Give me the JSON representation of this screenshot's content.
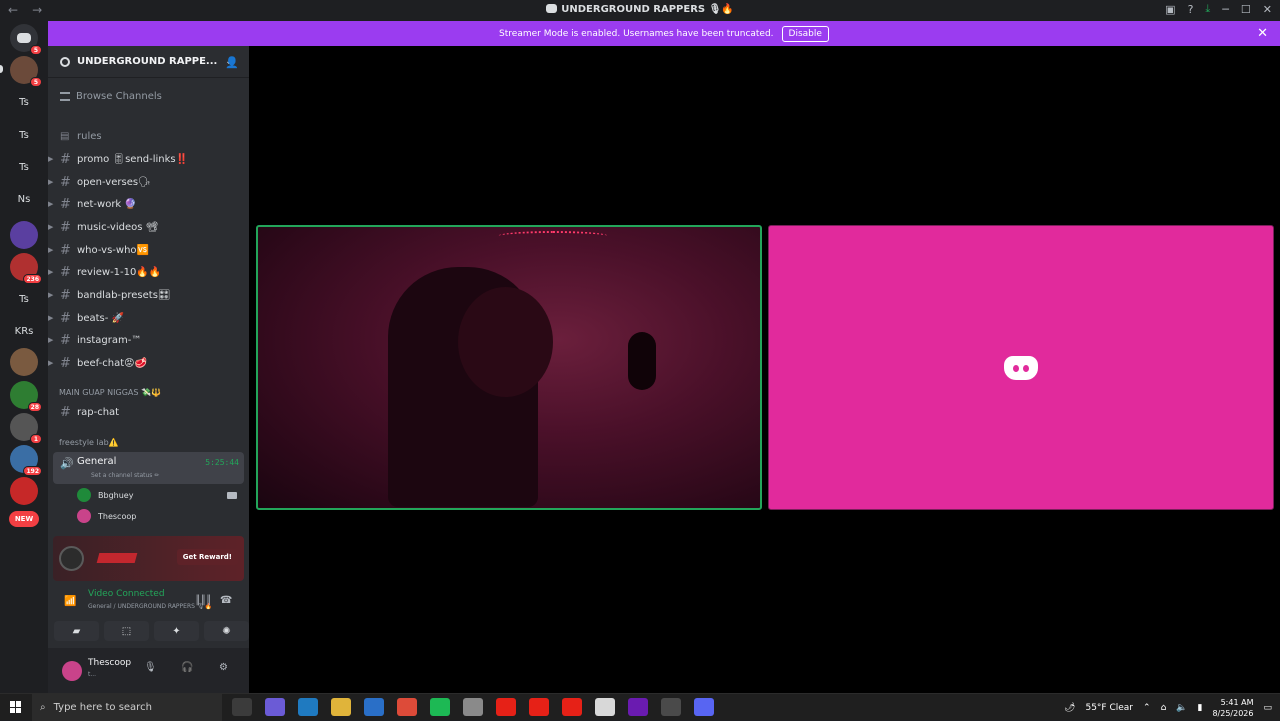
{
  "titlebar": {
    "title": "UNDERGROUND RAPPERS 🎙🔥",
    "back": "←",
    "forward": "→",
    "controls": {
      "minimize": "─",
      "maximize": "☐",
      "close": "✕"
    }
  },
  "banner": {
    "text": "Streamer Mode is enabled. Usernames have been truncated.",
    "button": "Disable"
  },
  "servers": [
    {
      "kind": "home",
      "badge": "5"
    },
    {
      "kind": "image",
      "badge": "5",
      "color": "#6b4a3a"
    },
    {
      "kind": "text",
      "label": "Ts"
    },
    {
      "kind": "text",
      "label": "Ts"
    },
    {
      "kind": "text",
      "label": "Ts"
    },
    {
      "kind": "text",
      "label": "Ns"
    },
    {
      "kind": "image",
      "color": "#5a3fa0"
    },
    {
      "kind": "image",
      "badge": "236",
      "color": "#b03030"
    },
    {
      "kind": "text",
      "label": "Ts"
    },
    {
      "kind": "text",
      "label": "KRs"
    },
    {
      "kind": "image",
      "color": "#7a5a40"
    },
    {
      "kind": "image",
      "badge": "28",
      "color": "#2e7d32"
    },
    {
      "kind": "image",
      "badge": "1",
      "color": "#555555"
    },
    {
      "kind": "image",
      "badge": "192",
      "color": "#3a6ea5"
    },
    {
      "kind": "image",
      "color": "#c62828"
    },
    {
      "kind": "new",
      "label": "NEW"
    }
  ],
  "guild": {
    "name": "UNDERGROUND RAPPE...",
    "browse": "Browse Channels"
  },
  "channels": [
    {
      "name": "rules",
      "dim": true,
      "icon": "rules"
    },
    {
      "name": "promo 🎚send-links‼️"
    },
    {
      "name": "open-verses🗣"
    },
    {
      "name": "net-work 🔮"
    },
    {
      "name": "music-videos 📽"
    },
    {
      "name": "who-vs-who🆚"
    },
    {
      "name": "review-1-10🔥🔥"
    },
    {
      "name": "bandlab-presets🎛"
    },
    {
      "name": "beats- 🚀"
    },
    {
      "name": "instagram-™"
    },
    {
      "name": "beef-chat😡🥩"
    }
  ],
  "category_main": "MAIN GUAP NIGGAS 💸🔱",
  "rap_chat": "rap-chat",
  "category_freestyle": "freestyle lab⚠️",
  "voice_channel": {
    "name": "General",
    "time": "5:25:44",
    "status": "Set a channel status ✏"
  },
  "voice_users": [
    {
      "name": "Bbghuey",
      "color": "#1f8a3a",
      "camera": true
    },
    {
      "name": "Thescoop",
      "color": "#c9438a",
      "camera": false
    }
  ],
  "promo": {
    "button": "Get Reward!",
    "logo": "NBA 2K"
  },
  "voice_status": {
    "title": "Video Connected",
    "sub": "General / UNDERGROUND RAPPERS 🎙🔥"
  },
  "user": {
    "name": "Thescoop",
    "sub": "t..."
  },
  "taskbar": {
    "search": "Type here to search",
    "weather": "55°F  Clear",
    "time": "5:41 AM",
    "date": "8/25/2026"
  },
  "colors": {
    "accent": "#9b3cf0",
    "green": "#23a55a",
    "avatar_bg": "#e12a9c"
  }
}
